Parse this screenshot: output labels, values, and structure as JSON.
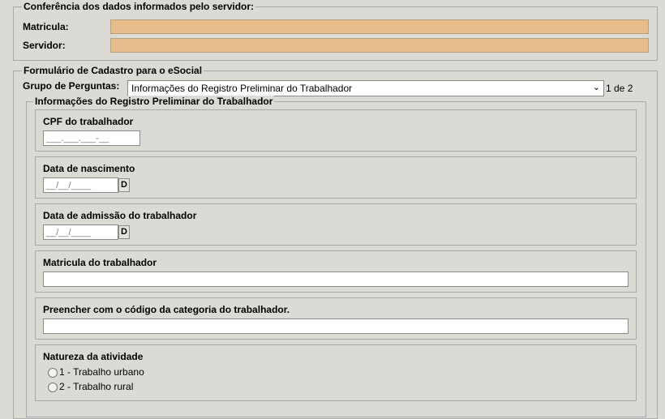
{
  "conferencia": {
    "legend": "Conferência dos dados informados pelo servidor:",
    "matricula_label": "Matricula:",
    "matricula_value": "",
    "servidor_label": "Servidor:",
    "servidor_value": ""
  },
  "formulario": {
    "legend": "Formulário de Cadastro para o eSocial",
    "grupo_label": "Grupo de Perguntas:",
    "grupo_selected": "Informações do Registro Preliminar do Trabalhador",
    "grupo_page": "1 de 2",
    "registro": {
      "legend": "Informações do Registro Preliminar do Trabalhador",
      "cpf_label": "CPF do trabalhador",
      "cpf_mask": "___.___.___-__",
      "nascimento_label": "Data de nascimento",
      "nascimento_mask": "__/__/____",
      "admissao_label": "Data de admissão do trabalhador",
      "admissao_mask": "__/__/____",
      "date_button": "D",
      "matricula_label": "Matricula do trabalhador",
      "categoria_label": "Preencher com o código da categoria do trabalhador.",
      "natureza_label": "Natureza da atividade",
      "natureza_options": [
        "1 - Trabalho urbano",
        "2 - Trabalho rural"
      ]
    }
  }
}
